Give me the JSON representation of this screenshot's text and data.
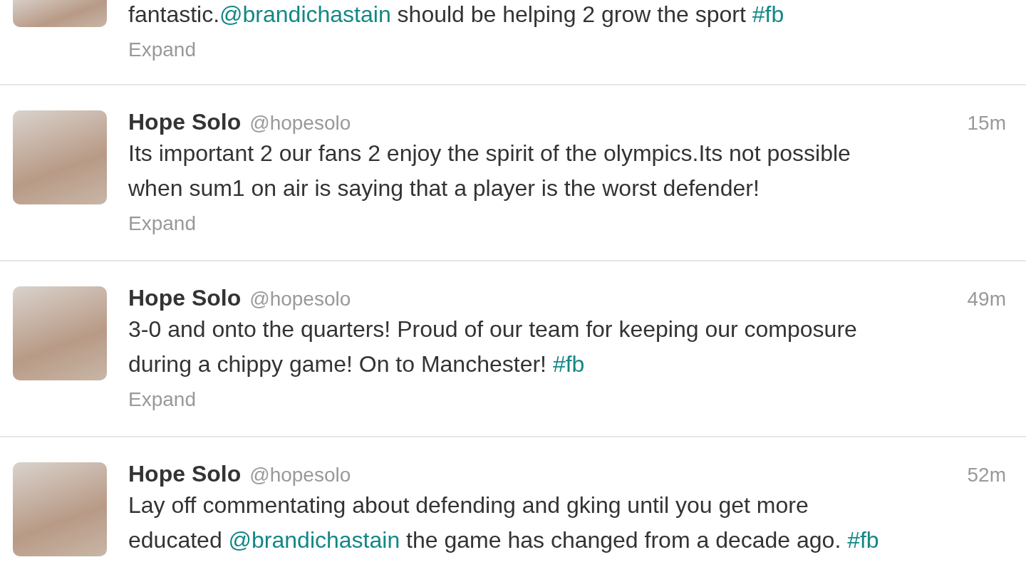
{
  "tweets": [
    {
      "kind": "cut_off",
      "lines": [
        [
          {
            "kind": "text",
            "text": "fantastic."
          },
          {
            "kind": "mention",
            "text": "@brandichastain"
          },
          {
            "kind": "text",
            "text": " should be helping 2 grow the sport "
          },
          {
            "kind": "hashtag",
            "text": "#fb"
          }
        ]
      ],
      "expand": "Expand"
    },
    {
      "kind": "full",
      "name": "Hope Solo",
      "handle": "@hopesolo",
      "time": "15m",
      "lines": [
        [
          {
            "kind": "text",
            "text": "Its important 2 our fans 2 enjoy the spirit of the olympics.Its not possible"
          }
        ],
        [
          {
            "kind": "text",
            "text": "when sum1 on air is saying that a player is the worst defender!"
          }
        ]
      ],
      "expand": "Expand"
    },
    {
      "kind": "full",
      "name": "Hope Solo",
      "handle": "@hopesolo",
      "time": "49m",
      "lines": [
        [
          {
            "kind": "text",
            "text": "3-0 and onto the quarters! Proud of our team for keeping our composure"
          }
        ],
        [
          {
            "kind": "text",
            "text": "during a chippy game! On to Manchester! "
          },
          {
            "kind": "hashtag",
            "text": "#fb"
          }
        ]
      ],
      "expand": "Expand"
    },
    {
      "kind": "full",
      "name": "Hope Solo",
      "handle": "@hopesolo",
      "time": "52m",
      "lines": [
        [
          {
            "kind": "text",
            "text": "Lay off commentating about defending and gking until you get more"
          }
        ],
        [
          {
            "kind": "text",
            "text": "educated "
          },
          {
            "kind": "mention",
            "text": "@brandichastain"
          },
          {
            "kind": "text",
            "text": " the game has changed from a decade ago. "
          },
          {
            "kind": "hashtag",
            "text": "#fb"
          }
        ]
      ]
    }
  ]
}
